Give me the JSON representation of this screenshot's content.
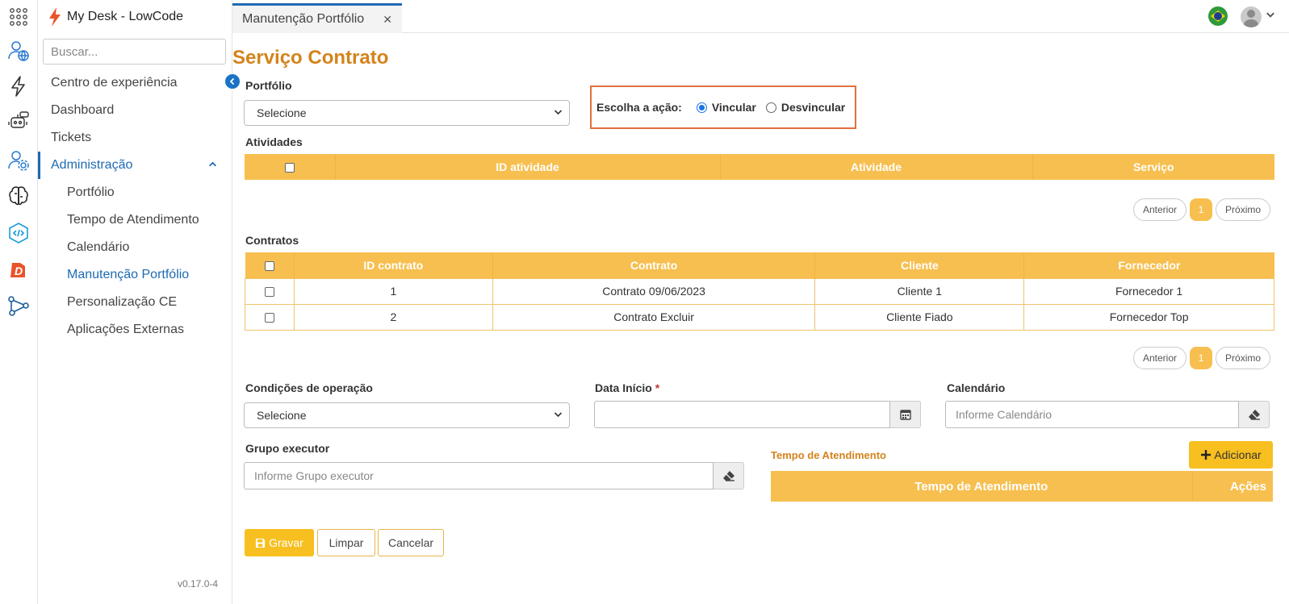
{
  "app": {
    "title": "My Desk - LowCode",
    "version": "v0.17.0-4"
  },
  "sidebar": {
    "search_placeholder": "Buscar...",
    "items": [
      {
        "label": "Centro de experiência"
      },
      {
        "label": "Dashboard"
      },
      {
        "label": "Tickets"
      },
      {
        "label": "Administração"
      }
    ],
    "sub_items": [
      {
        "label": "Portfólio"
      },
      {
        "label": "Tempo de Atendimento"
      },
      {
        "label": "Calendário"
      },
      {
        "label": "Manutenção Portfólio"
      },
      {
        "label": "Personalização CE"
      },
      {
        "label": "Aplicações Externas"
      }
    ]
  },
  "tabs": [
    {
      "label": "Manutenção Portfólio"
    }
  ],
  "page": {
    "title": "Serviço Contrato",
    "portfolio_label": "Portfólio",
    "portfolio_value": "Selecione",
    "action_label": "Escolha a ação:",
    "action_options": [
      {
        "label": "Vincular",
        "selected": true
      },
      {
        "label": "Desvincular",
        "selected": false
      }
    ],
    "atividades_label": "Atividades",
    "atividades_headers": [
      "ID atividade",
      "Atividade",
      "Serviço"
    ],
    "contratos_label": "Contratos",
    "contratos_headers": [
      "ID contrato",
      "Contrato",
      "Cliente",
      "Fornecedor"
    ],
    "contratos_rows": [
      [
        "1",
        "Contrato 09/06/2023",
        "Cliente 1",
        "Fornecedor 1"
      ],
      [
        "2",
        "Contrato Excluir",
        "Cliente Fiado",
        "Fornecedor Top"
      ]
    ],
    "pager": {
      "prev": "Anterior",
      "page": "1",
      "next": "Próximo"
    },
    "condicoes_label": "Condições de operação",
    "condicoes_value": "Selecione",
    "data_inicio_label": "Data Início",
    "data_inicio_required": "*",
    "calendario_label": "Calendário",
    "calendario_placeholder": "Informe Calendário",
    "grupo_label": "Grupo executor",
    "grupo_placeholder": "Informe Grupo executor",
    "tempo_title": "Tempo de Atendimento",
    "adicionar_label": "Adicionar",
    "tempo_headers": [
      "Tempo de Atendimento",
      "Ações"
    ],
    "buttons": {
      "gravar": "Gravar",
      "limpar": "Limpar",
      "cancelar": "Cancelar"
    }
  },
  "colors": {
    "accent": "#f7bf4f",
    "brand": "#1d6ab3",
    "title": "#d4831b",
    "highlight": "#e07040"
  }
}
